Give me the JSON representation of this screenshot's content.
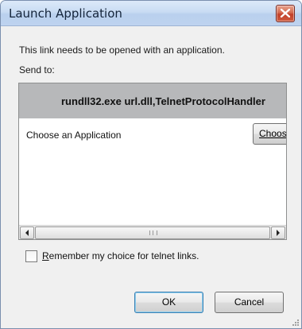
{
  "window": {
    "title": "Launch Application"
  },
  "message": "This link needs to be opened with an application.",
  "send_to_label": "Send to:",
  "command": "rundll32.exe url.dll,TelnetProtocolHandler",
  "choose_application_label": "Choose an Application",
  "choose_button_label": "Choose...",
  "remember_choice": {
    "label_accesskey": "R",
    "label_rest": "emember my choice for telnet links.",
    "checked": false
  },
  "buttons": {
    "ok": "OK",
    "cancel": "Cancel"
  },
  "icons": {
    "close": "close-icon",
    "scroll_left": "arrow-left-icon",
    "scroll_right": "arrow-right-icon",
    "scroll_grip": "grip-icon",
    "resize": "resize-grip-icon"
  },
  "colors": {
    "title_bar": "#c9dcf3",
    "close_button": "#c2402a",
    "command_band": "#b7b8ba",
    "ok_button_border": "#3c7fb1"
  }
}
